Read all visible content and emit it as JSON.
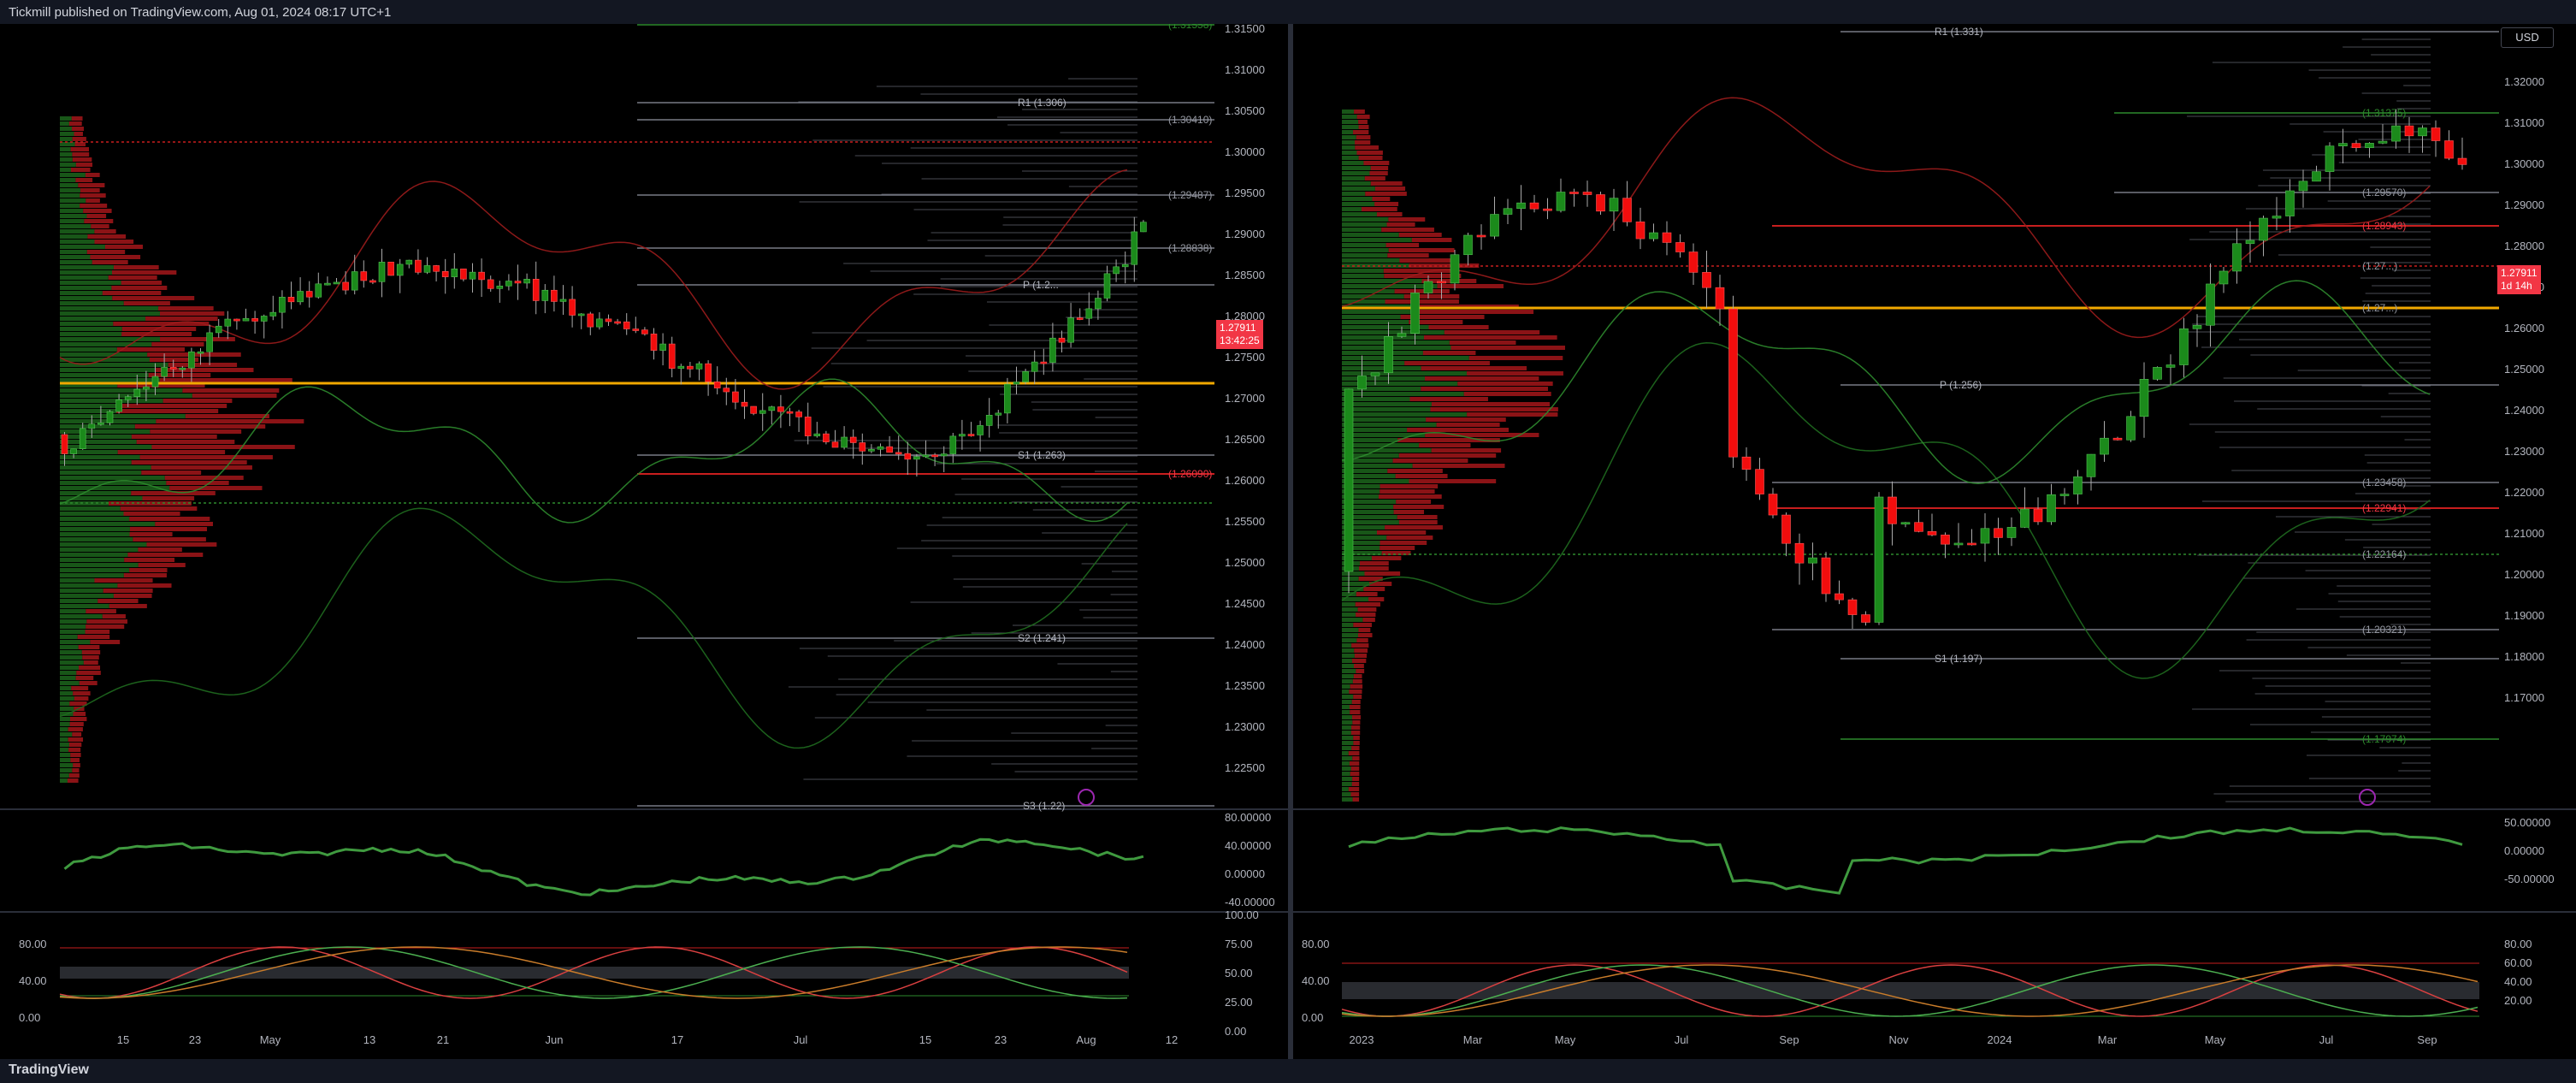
{
  "header": {
    "publisher_line": "Tickmill published on TradingView.com, Aug 01, 2024 08:17 UTC+1"
  },
  "footer": {
    "brand": "TradingView"
  },
  "left_chart": {
    "price_ticks": [
      "1.31500",
      "1.31000",
      "1.30500",
      "1.30000",
      "1.29500",
      "1.29000",
      "1.28500",
      "1.28000",
      "1.27500",
      "1.27000",
      "1.26500",
      "1.26000",
      "1.25500",
      "1.25000",
      "1.24500",
      "1.24000",
      "1.23500",
      "1.23000",
      "1.22500"
    ],
    "time_ticks": [
      "15",
      "23",
      "May",
      "13",
      "21",
      "Jun",
      "17",
      "Jul",
      "15",
      "23",
      "Aug",
      "12"
    ],
    "level_labels": {
      "r1": "R1 (1.306)",
      "p": "P (1.2...",
      "s1": "S1 (1.263)",
      "s2": "S2 (1.241)",
      "s3": "S3 (1.22)",
      "l1": "(1.31558)",
      "l2": "(1.30410)",
      "l3": "(1.29487)",
      "l4": "(1.28838)",
      "l5": "(1.26090)"
    },
    "last_price": "1.27911",
    "countdown": "13:42:25",
    "osc1_ticks": [
      "80.00000",
      "40.00000",
      "0.00000",
      "-40.00000"
    ],
    "osc2_left_ticks": [
      "80.00",
      "40.00",
      "0.00"
    ],
    "osc2_right_ticks": [
      "100.00",
      "75.00",
      "50.00",
      "25.00",
      "0.00"
    ]
  },
  "right_chart": {
    "currency": "USD",
    "price_ticks": [
      "1.32000",
      "1.31000",
      "1.30000",
      "1.29000",
      "1.28000",
      "1.27000",
      "1.26000",
      "1.25000",
      "1.24000",
      "1.23000",
      "1.22000",
      "1.21000",
      "1.20000",
      "1.19000",
      "1.18000",
      "1.17000"
    ],
    "time_ticks": [
      "2023",
      "Mar",
      "May",
      "Jul",
      "Sep",
      "Nov",
      "2024",
      "Mar",
      "May",
      "Jul",
      "Sep"
    ],
    "level_labels": {
      "r1": "R1 (1.331)",
      "p": "P (1.256)",
      "s1": "S1 (1.197)",
      "l1": "(1.31375)",
      "l2": "(1.29570)",
      "l3": "(1.28943)",
      "l4": "(1.27...)",
      "l5": "(1.27...)",
      "l6": "(1.23458)",
      "l7": "(1.22941)",
      "l8": "(1.22164)",
      "l9": "(1.20321)",
      "l10": "(1.17974)"
    },
    "last_price": "1.27911",
    "countdown": "1d 14h",
    "osc1_ticks": [
      "50.00000",
      "0.00000",
      "-50.00000"
    ],
    "osc2_left_ticks": [
      "80.00",
      "40.00",
      "0.00"
    ],
    "osc2_right_ticks": [
      "80.00",
      "60.00",
      "40.00",
      "20.00"
    ]
  },
  "colors": {
    "up": "#1b7a1b",
    "down": "#f20d0d",
    "accent": "#f2a900",
    "bg": "#000000"
  }
}
